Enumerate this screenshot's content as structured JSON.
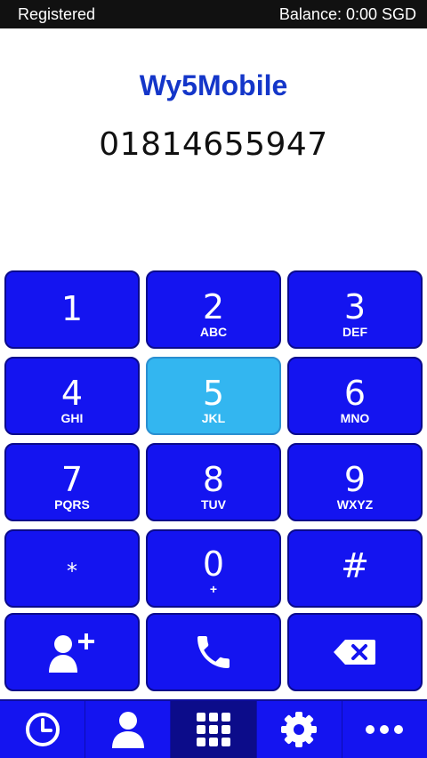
{
  "status_bar": {
    "registration": "Registered",
    "balance": "Balance: 0:00 SGD"
  },
  "app": {
    "title": "Wy5Mobile"
  },
  "dialer": {
    "number": "01814655947"
  },
  "keypad": {
    "keys": [
      {
        "digit": "1",
        "letters": ""
      },
      {
        "digit": "2",
        "letters": "ABC"
      },
      {
        "digit": "3",
        "letters": "DEF"
      },
      {
        "digit": "4",
        "letters": "GHI"
      },
      {
        "digit": "5",
        "letters": "JKL"
      },
      {
        "digit": "6",
        "letters": "MNO"
      },
      {
        "digit": "7",
        "letters": "PQRS"
      },
      {
        "digit": "8",
        "letters": "TUV"
      },
      {
        "digit": "9",
        "letters": "WXYZ"
      },
      {
        "digit": "*",
        "letters": ""
      },
      {
        "digit": "0",
        "letters": "+"
      },
      {
        "digit": "#",
        "letters": ""
      }
    ],
    "pressed_key": "5",
    "actions": [
      {
        "icon": "add-contact-icon"
      },
      {
        "icon": "phone-icon"
      },
      {
        "icon": "backspace-icon"
      }
    ]
  },
  "nav": {
    "items": [
      {
        "icon": "history-icon"
      },
      {
        "icon": "contacts-icon"
      },
      {
        "icon": "dialpad-icon"
      },
      {
        "icon": "settings-icon"
      },
      {
        "icon": "more-icon"
      }
    ],
    "active_icon": "dialpad-icon"
  },
  "colors": {
    "accent": "#1414f0",
    "pressed": "#33b6f0",
    "title": "#1436c9",
    "nav_active": "#0c0c8a",
    "status_bar": "#111111"
  }
}
